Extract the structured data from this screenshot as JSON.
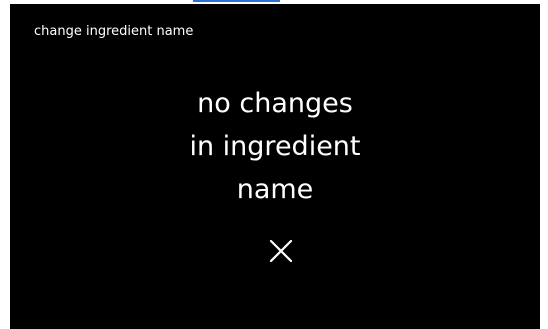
{
  "header": {
    "title": "change ingredient name"
  },
  "message": {
    "line1": "no changes",
    "line2": "in ingredient",
    "line3": "name"
  },
  "actions": {
    "close_icon": "close-icon",
    "close_symbol": "×"
  },
  "colors": {
    "screen_background": "#000000",
    "text": "#ffffff",
    "top_link_accent": "#2f6fd6"
  }
}
